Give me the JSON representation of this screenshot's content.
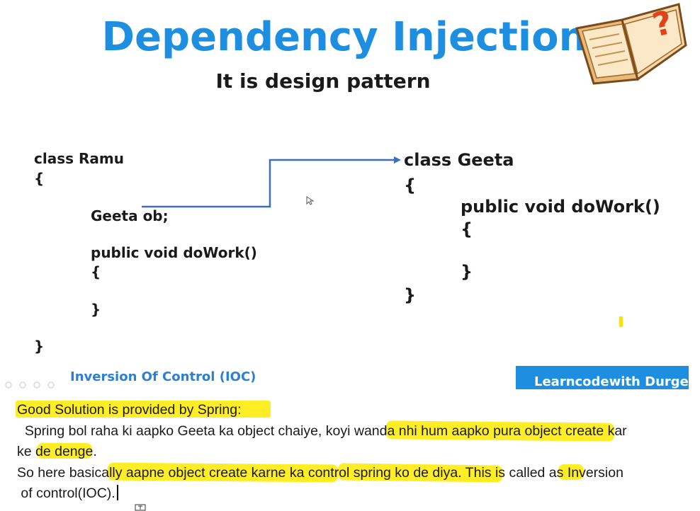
{
  "slide": {
    "title": "Dependency Injection",
    "subtitle": "It is design pattern",
    "book_icon": "book-question-icon",
    "ramu": {
      "header": "class Ramu",
      "open_brace": "{",
      "field": "Geeta ob;",
      "method": "public void doWork()",
      "method_open": "{",
      "method_close": "}",
      "close_brace": "}"
    },
    "geeta": {
      "header": "class Geeta",
      "open_brace": "{",
      "method": "public void doWork()",
      "method_open": "{",
      "method_close": "}",
      "close_brace": "}"
    },
    "ioc_label": "Inversion Of Control (IOC)",
    "brand": "Learncodewith Durges",
    "colors": {
      "title": "#1e8fe0",
      "arrow": "#3a6fc0",
      "brand_bg": "#1e8fe0",
      "highlight": "#ffeb00"
    }
  },
  "notes": {
    "heading": "Good Solution is provided by Spring:",
    "line1": "  Spring bol raha ki aapko Geeta ka object chaiye, koyi wanda nhi hum aapko pura object create kar",
    "line2": "ke de denge.",
    "line3": "So here basically aapne object create karne ka control spring ko de diya. This is called as Inversion",
    "line4": " of control(IOC)."
  }
}
